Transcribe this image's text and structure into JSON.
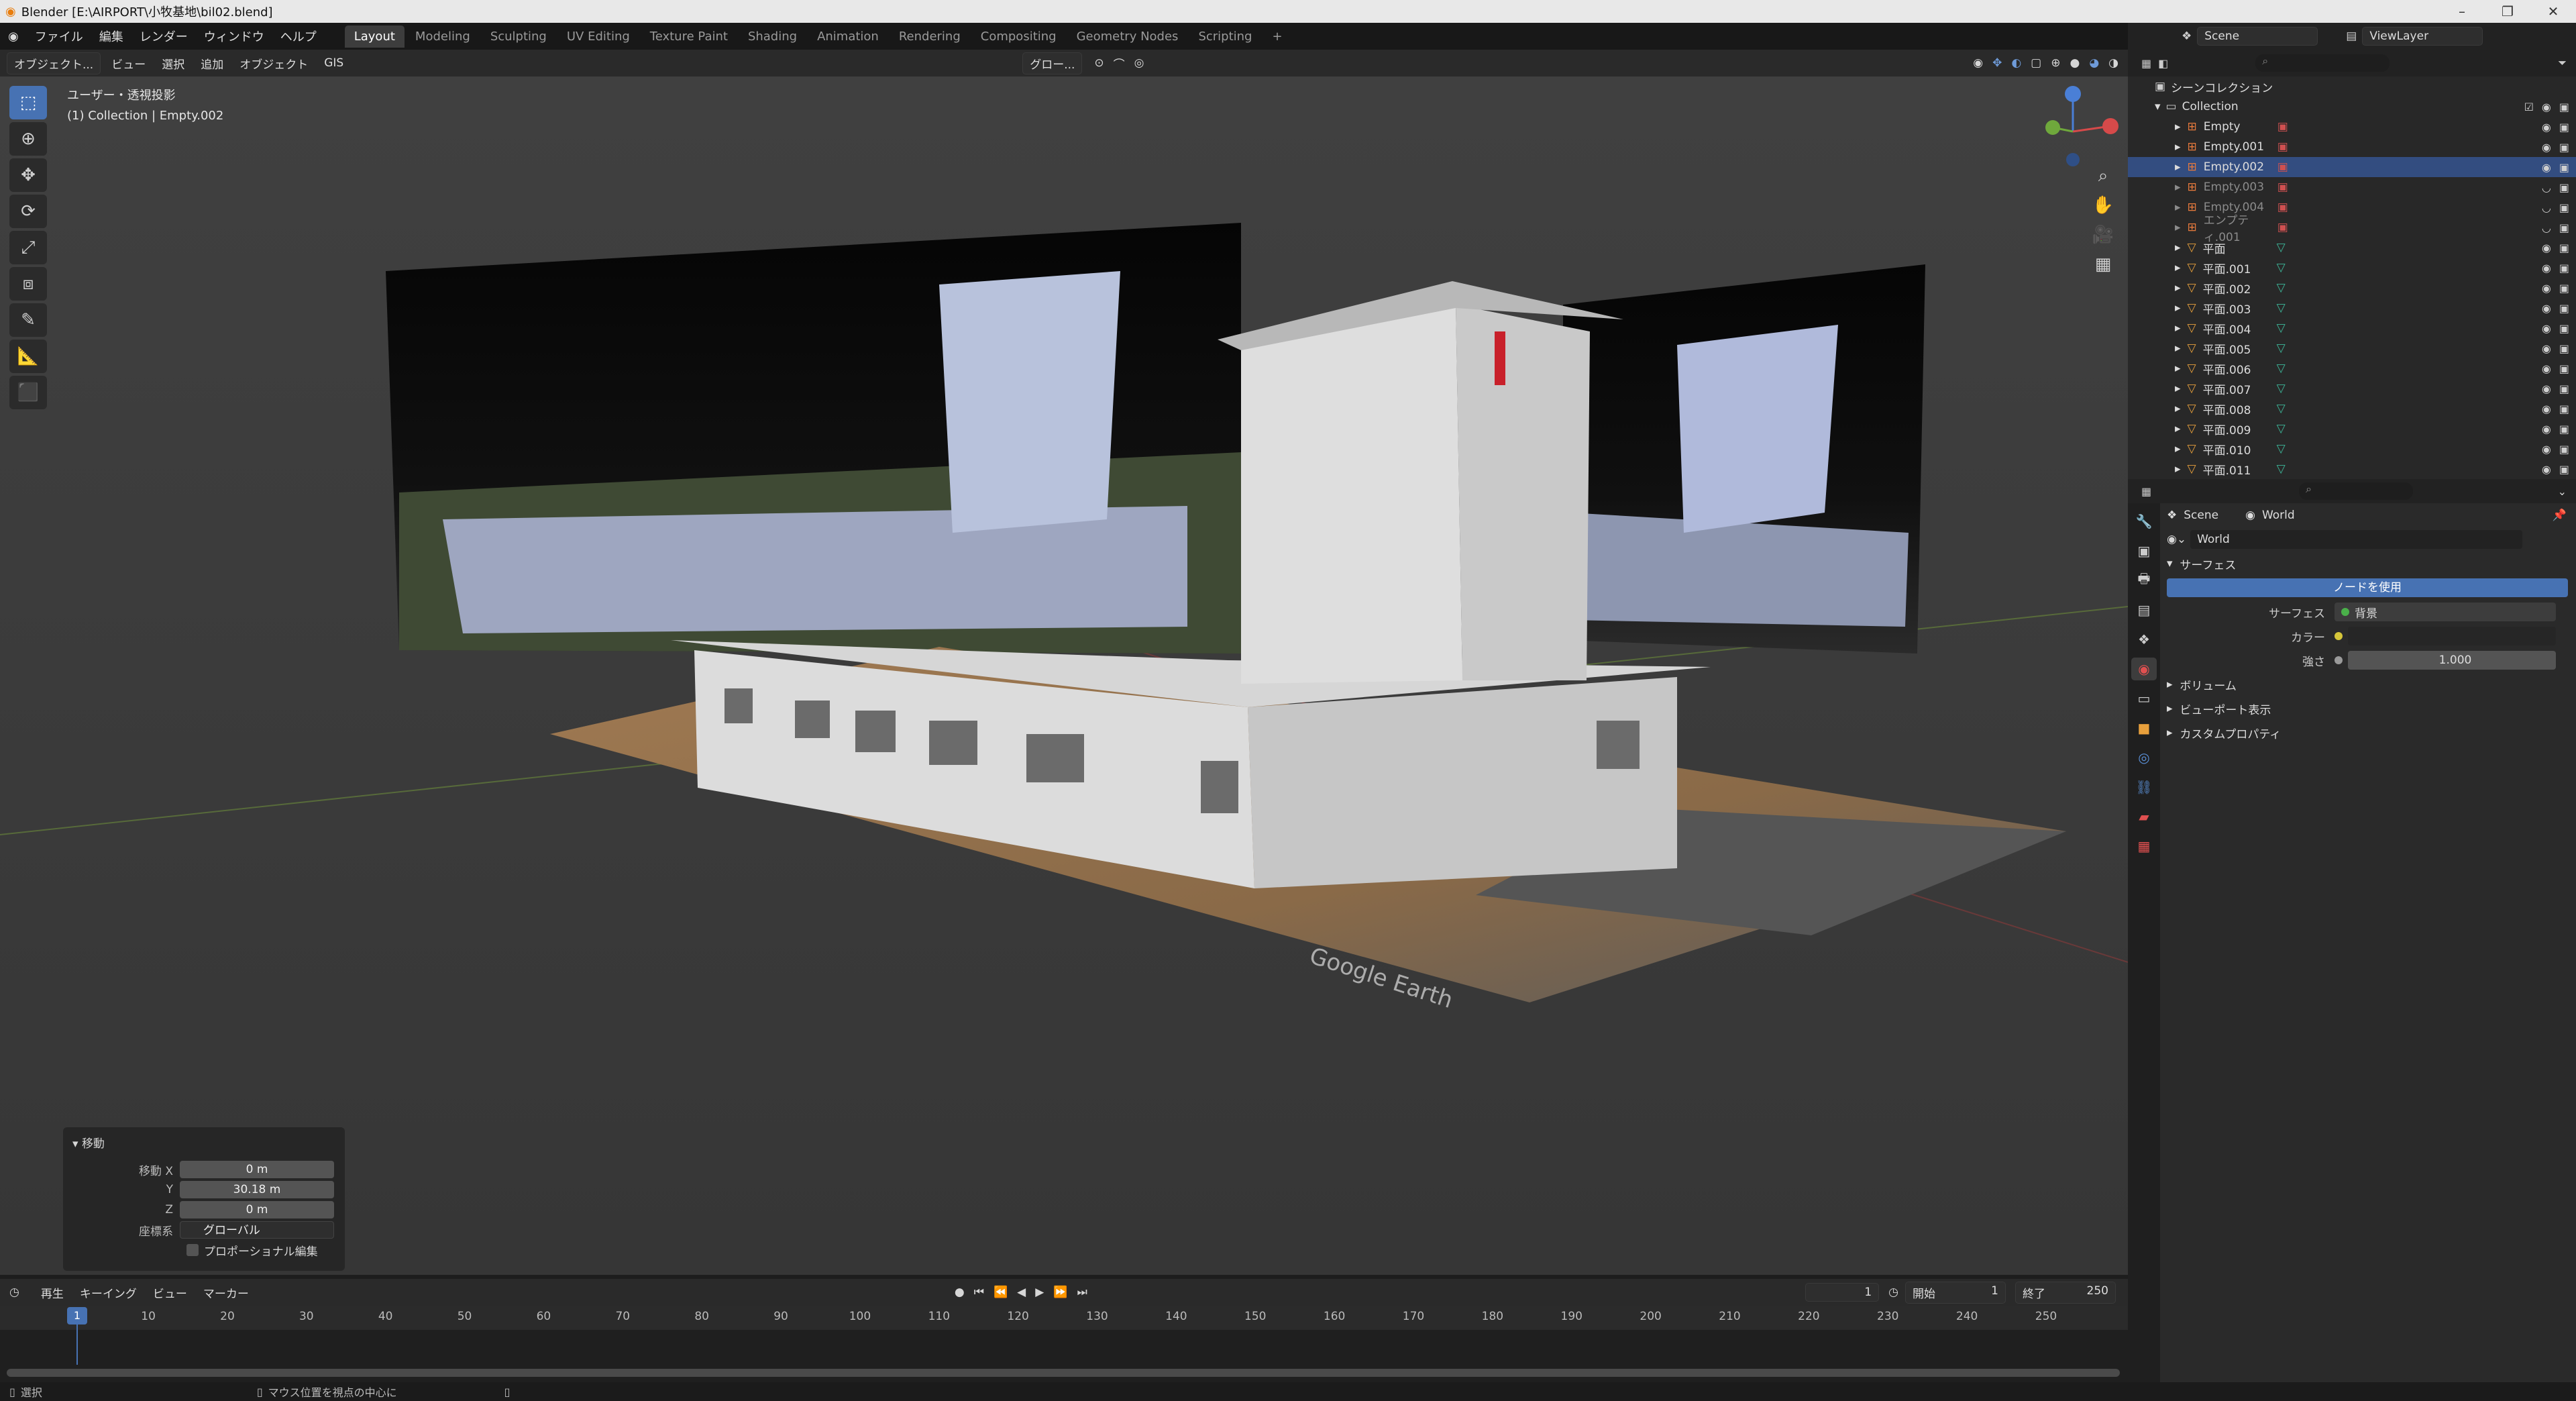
{
  "window": {
    "title": "Blender [E:\\AIRPORT\\小牧基地\\bil02.blend]"
  },
  "menus": [
    "ファイル",
    "編集",
    "レンダー",
    "ウィンドウ",
    "ヘルプ"
  ],
  "workspaces": [
    {
      "label": "Layout",
      "active": true
    },
    {
      "label": "Modeling"
    },
    {
      "label": "Sculpting"
    },
    {
      "label": "UV Editing"
    },
    {
      "label": "Texture Paint"
    },
    {
      "label": "Shading"
    },
    {
      "label": "Animation"
    },
    {
      "label": "Rendering"
    },
    {
      "label": "Compositing"
    },
    {
      "label": "Geometry Nodes"
    },
    {
      "label": "Scripting"
    }
  ],
  "add_workspace": "+",
  "scene": {
    "name": "Scene",
    "view_layer": "ViewLayer"
  },
  "viewport_header": {
    "mode": "オブジェクト...",
    "items": [
      "ビュー",
      "選択",
      "追加",
      "オブジェクト",
      "GIS"
    ],
    "transform_orientation": "グロー..."
  },
  "viewport": {
    "view_label": "ユーザー・透視投影",
    "collection_label": "(1) Collection | Empty.002",
    "watermark": "Google Earth"
  },
  "redo_panel": {
    "title": "移動",
    "x_label": "移動 X",
    "x": "0 m",
    "y_label": "Y",
    "y": "30.18 m",
    "z_label": "Z",
    "z": "0 m",
    "orient_label": "座標系",
    "orient": "グローバル",
    "proportional": "プロポーショナル編集"
  },
  "timeline": {
    "menus": [
      "再生",
      "キーイング",
      "ビュー",
      "マーカー"
    ],
    "current_frame": "1",
    "start_label": "開始",
    "start": "1",
    "end_label": "終了",
    "end": "250",
    "ticks": [
      "1",
      "10",
      "20",
      "30",
      "40",
      "50",
      "60",
      "70",
      "80",
      "90",
      "100",
      "110",
      "120",
      "130",
      "140",
      "150",
      "160",
      "170",
      "180",
      "190",
      "200",
      "210",
      "220",
      "230",
      "240",
      "250"
    ]
  },
  "statusbar": {
    "left": "選択",
    "mid": "マウス位置を視点の中心に"
  },
  "outliner": {
    "root": "シーンコレクション",
    "collection": "Collection",
    "items": [
      {
        "name": "Empty",
        "type": "empty"
      },
      {
        "name": "Empty.001",
        "type": "empty"
      },
      {
        "name": "Empty.002",
        "type": "empty",
        "selected": true
      },
      {
        "name": "Empty.003",
        "type": "empty",
        "dim": true
      },
      {
        "name": "Empty.004",
        "type": "empty",
        "dim": true
      },
      {
        "name": "エンプティ.001",
        "type": "empty",
        "dim": true
      },
      {
        "name": "平面",
        "type": "mesh"
      },
      {
        "name": "平面.001",
        "type": "mesh"
      },
      {
        "name": "平面.002",
        "type": "mesh"
      },
      {
        "name": "平面.003",
        "type": "mesh"
      },
      {
        "name": "平面.004",
        "type": "mesh"
      },
      {
        "name": "平面.005",
        "type": "mesh"
      },
      {
        "name": "平面.006",
        "type": "mesh"
      },
      {
        "name": "平面.007",
        "type": "mesh"
      },
      {
        "name": "平面.008",
        "type": "mesh"
      },
      {
        "name": "平面.009",
        "type": "mesh"
      },
      {
        "name": "平面.010",
        "type": "mesh"
      },
      {
        "name": "平面.011",
        "type": "mesh"
      }
    ]
  },
  "properties": {
    "breadcrumb_scene": "Scene",
    "breadcrumb_world": "World",
    "world_name": "World",
    "surface_section": "サーフェス",
    "use_nodes": "ノードを使用",
    "surface_label": "サーフェス",
    "surface_value": "背景",
    "color_label": "カラー",
    "strength_label": "強さ",
    "strength": "1.000",
    "volume": "ボリューム",
    "viewport_display": "ビューポート表示",
    "custom_props": "カスタムプロパティ"
  },
  "colors": {
    "accent": "#4772b3",
    "selected_row": "#334d80",
    "mesh_icon": "#e8a03c",
    "empty_icon": "#e87a3c"
  }
}
